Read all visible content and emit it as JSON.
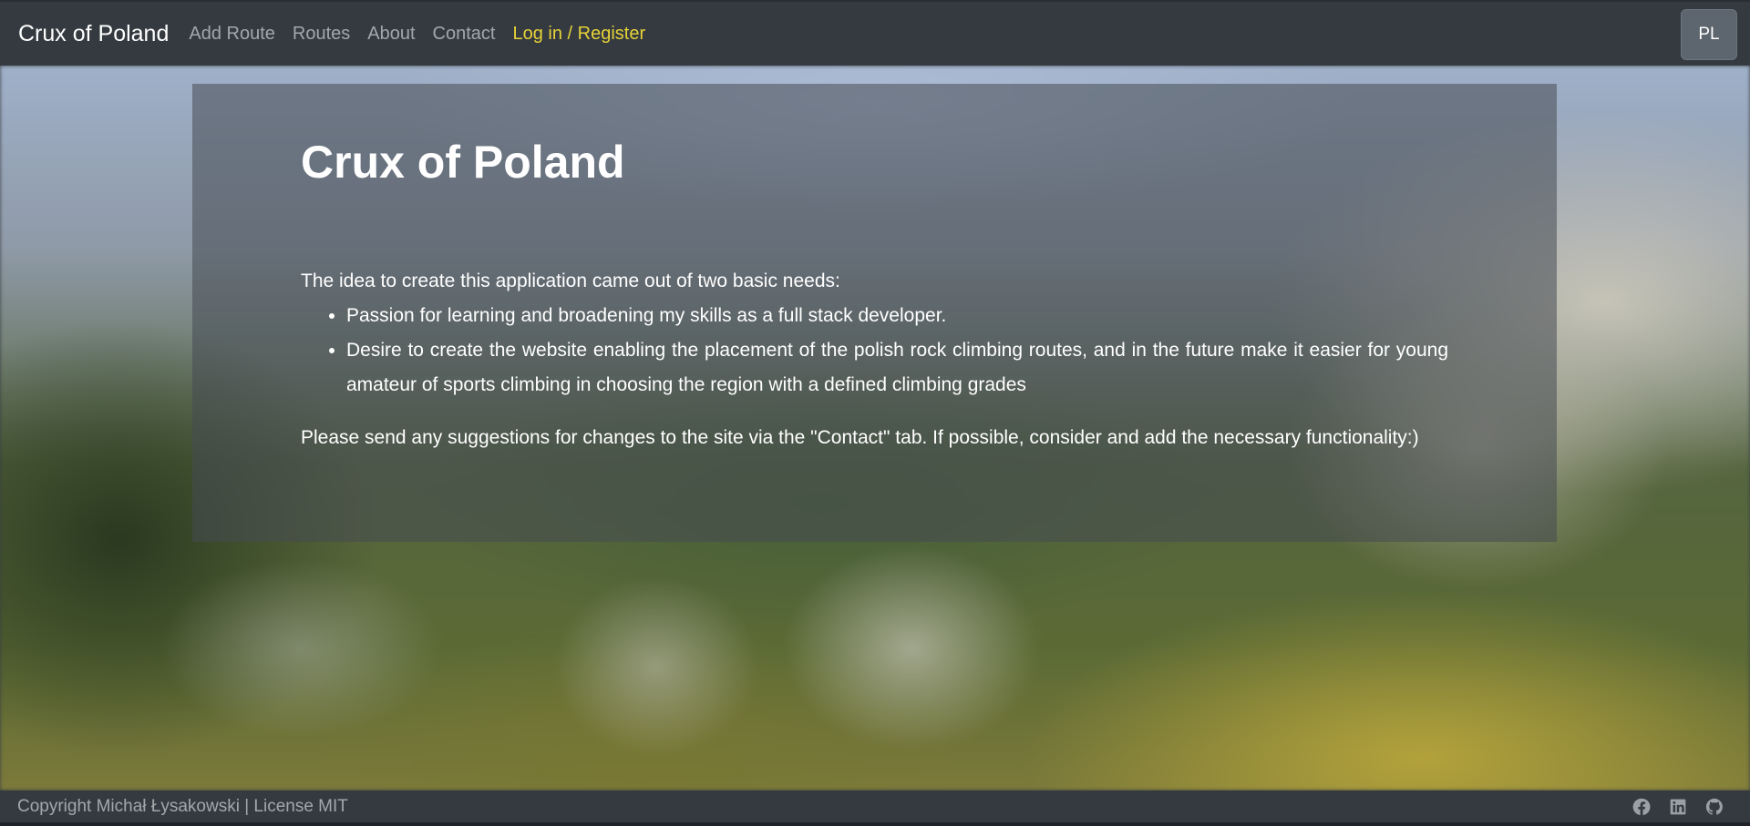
{
  "navbar": {
    "brand": "Crux of Poland",
    "links": [
      {
        "label": "Add Route"
      },
      {
        "label": "Routes"
      },
      {
        "label": "About"
      },
      {
        "label": "Contact"
      }
    ],
    "login_label": "Log in / Register",
    "language_button": "PL"
  },
  "main": {
    "title": "Crux of Poland",
    "intro": "The idea to create this application came out of two basic needs:",
    "needs": [
      "Passion for learning and broadening my skills as a full stack developer.",
      "Desire to create the website enabling the placement of the polish rock climbing routes, and in the future make it easier for young amateur of sports climbing in choosing the region with a defined climbing grades"
    ],
    "outro": "Please send any suggestions for changes to the site via the \"Contact\" tab. If possible, consider and add the necessary functionality:)"
  },
  "footer": {
    "copyright": "Copyright Michał Łysakowski | License MIT",
    "socials": [
      {
        "icon": "facebook-icon"
      },
      {
        "icon": "linkedin-icon"
      },
      {
        "icon": "github-icon"
      }
    ]
  },
  "colors": {
    "navbar_bg": "#343a40",
    "login_accent": "#e6d238",
    "card_overlay": "rgba(70,75,82,0.55)"
  }
}
